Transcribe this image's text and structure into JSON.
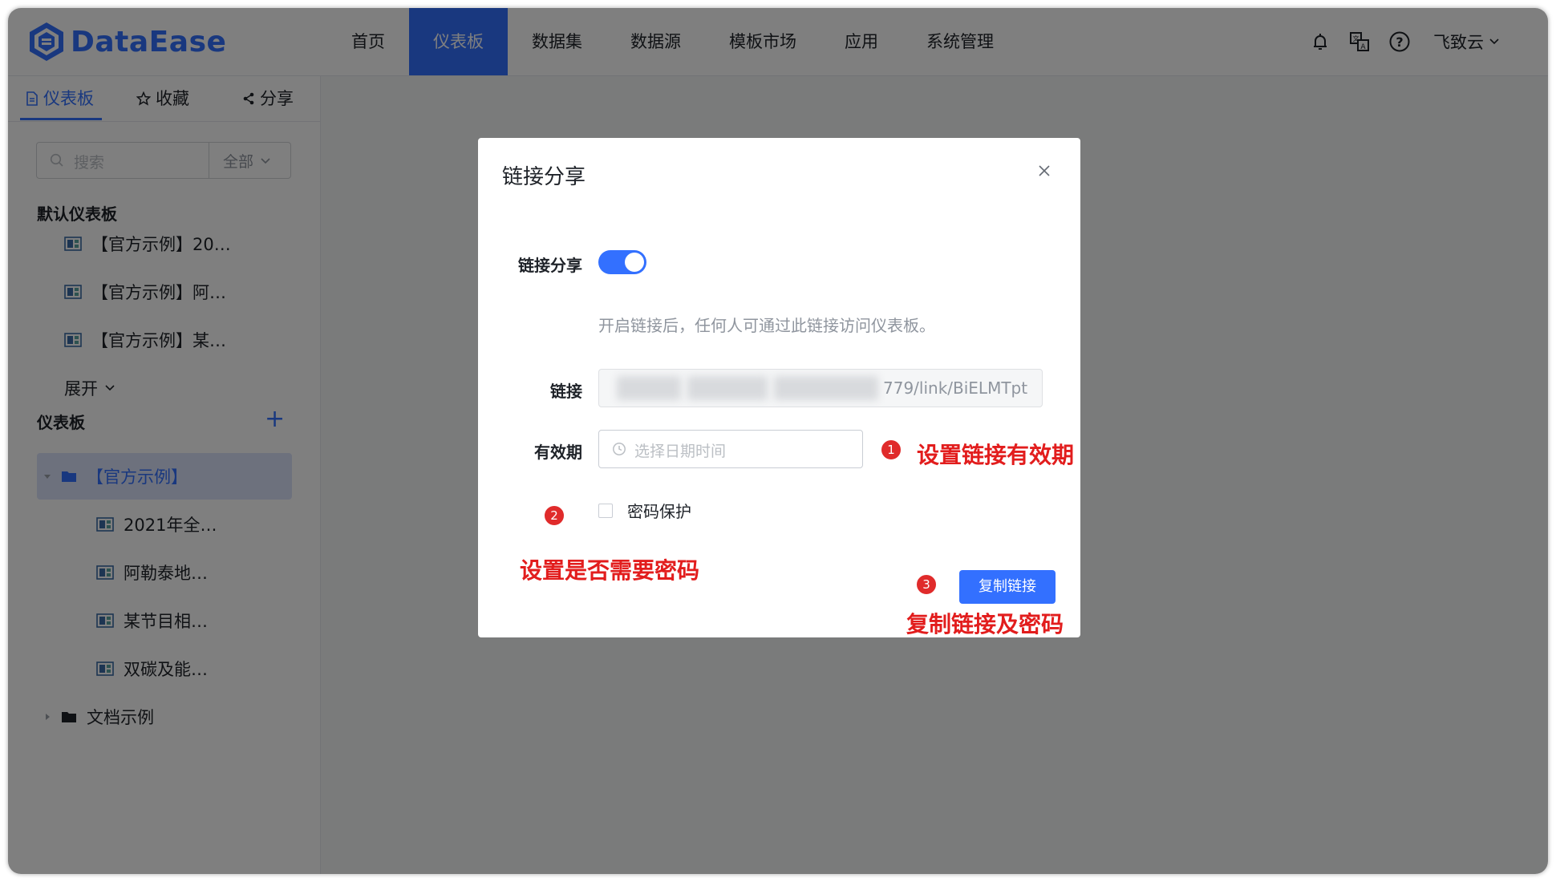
{
  "app": {
    "logo_text": "DataEase",
    "accent_color": "#3370ff"
  },
  "nav": {
    "items": [
      {
        "label": "首页"
      },
      {
        "label": "仪表板"
      },
      {
        "label": "数据集"
      },
      {
        "label": "数据源"
      },
      {
        "label": "模板市场"
      },
      {
        "label": "应用"
      },
      {
        "label": "系统管理"
      }
    ],
    "active": "仪表板"
  },
  "header": {
    "icons": [
      "bell-icon",
      "translate-icon",
      "help-icon"
    ],
    "user_name": "飞致云"
  },
  "sidebar": {
    "tabs": [
      {
        "label": "仪表板",
        "icon": "document-icon"
      },
      {
        "label": "收藏",
        "icon": "star-icon"
      },
      {
        "label": "分享",
        "icon": "share-icon"
      }
    ],
    "search_placeholder": "搜索",
    "filter_value": "全部",
    "default_section_title": "默认仪表板",
    "default_items": [
      "【官方示例】20…",
      "【官方示例】阿…",
      "【官方示例】某…"
    ],
    "expand_label": "展开",
    "dashboard_section_title": "仪表板",
    "folder_label": "【官方示例】",
    "folder_children": [
      "2021年全…",
      "阿勒泰地…",
      "某节目相…",
      "双碳及能…"
    ],
    "other_folder_label": "文档示例"
  },
  "dialog": {
    "title": "链接分享",
    "toggle_label": "链接分享",
    "toggle_on": true,
    "hint": "开启链接后，任何人可通过此链接访问仪表板。",
    "link_label": "链接",
    "link_value_visible": "779/link/BiELMTpt",
    "expiry_label": "有效期",
    "expiry_placeholder": "选择日期时间",
    "password_label": "密码保护",
    "password_checked": false,
    "copy_button": "复制链接"
  },
  "annotations": {
    "badge1": "1",
    "text1": "设置链接有效期",
    "badge2": "2",
    "text2": "设置是否需要密码",
    "badge3": "3",
    "text3": "复制链接及密码"
  }
}
